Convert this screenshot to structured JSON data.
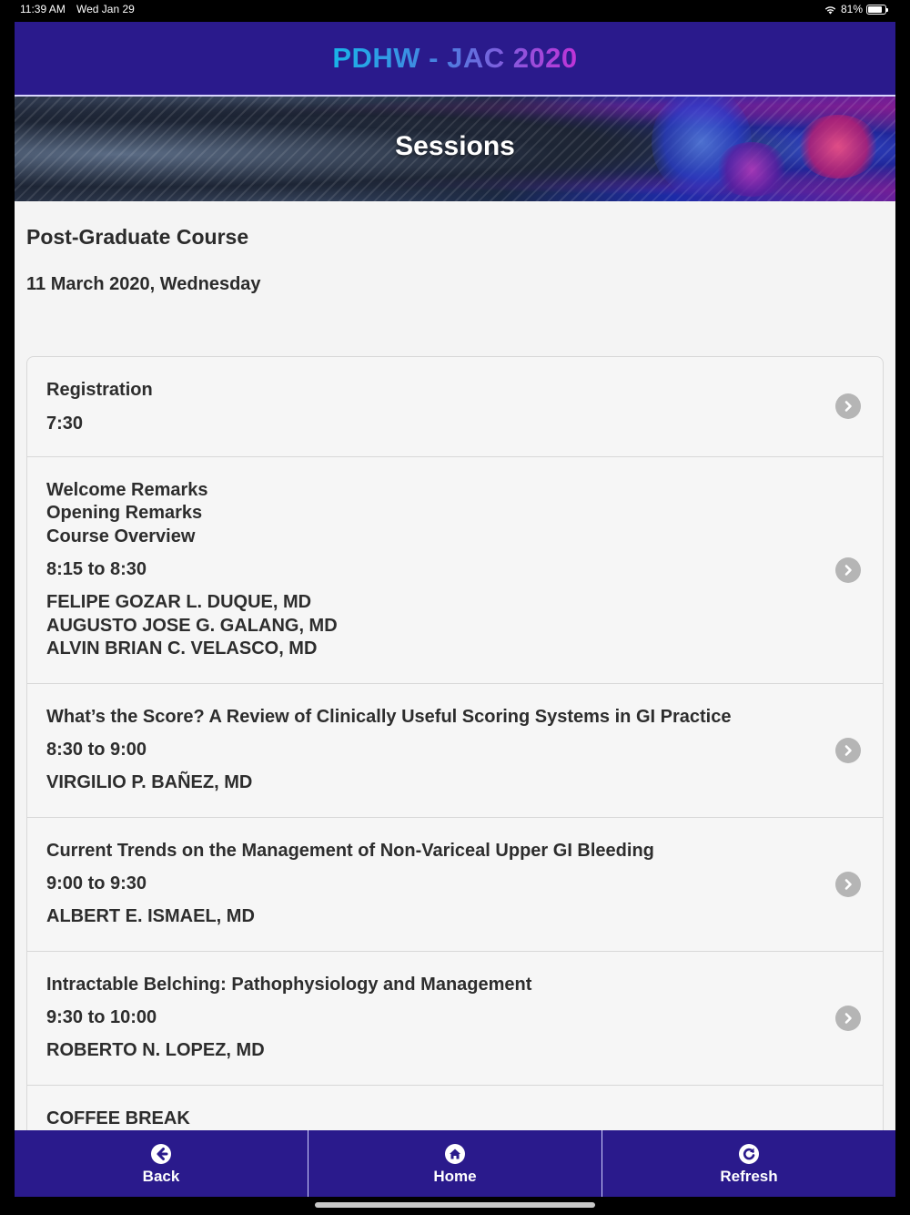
{
  "status": {
    "time": "11:39 AM",
    "date": "Wed Jan 29",
    "battery": "81%",
    "battery_level": 0.81
  },
  "header": {
    "title": "PDHW - JAC 2020"
  },
  "banner": {
    "heading": "Sessions"
  },
  "course": {
    "title": "Post-Graduate Course",
    "date": "11 March 2020, Wednesday"
  },
  "sessions": [
    {
      "title": "Registration",
      "time": "7:30",
      "speakers": ""
    },
    {
      "title": "Welcome Remarks\nOpening Remarks\nCourse Overview",
      "time": "8:15 to 8:30",
      "speakers": "FELIPE GOZAR L. DUQUE, MD\nAUGUSTO JOSE G. GALANG, MD\nALVIN BRIAN C. VELASCO, MD"
    },
    {
      "title": "What’s the Score? A Review of Clinically Useful Scoring Systems in GI Practice",
      "time": "8:30 to 9:00",
      "speakers": "VIRGILIO P. BAÑEZ, MD"
    },
    {
      "title": "Current Trends on the Management of Non-Variceal Upper GI Bleeding",
      "time": "9:00 to 9:30",
      "speakers": "ALBERT E. ISMAEL, MD"
    },
    {
      "title": "Intractable Belching: Pathophysiology and Management",
      "time": "9:30 to 10:00",
      "speakers": "ROBERTO N. LOPEZ, MD"
    },
    {
      "title": "COFFEE BREAK",
      "time": "",
      "speakers": ""
    }
  ],
  "footer": {
    "back_label": "Back",
    "home_label": "Home",
    "refresh_label": "Refresh"
  },
  "icons": {
    "back": "arrow-left-icon",
    "home": "home-icon",
    "refresh": "refresh-icon",
    "chevron": "chevron-right-icon"
  },
  "colors": {
    "brand": "#2a1a8c",
    "background": "#f4f4f4",
    "chevron": "#b5b5b5"
  }
}
